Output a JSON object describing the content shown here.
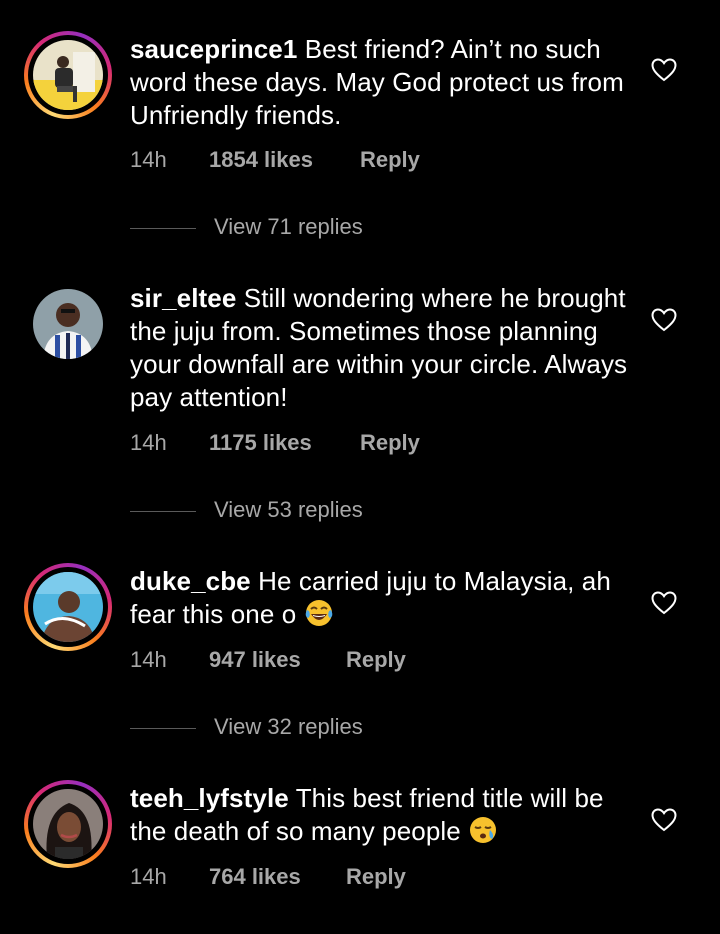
{
  "comments": [
    {
      "username": "sauceprince1",
      "text": "Best friend? Ain’t no such word these days. May God protect us from Unfriendly friends.",
      "time": "14h",
      "likes": "1854 likes",
      "reply": "Reply",
      "view_replies": "View 71 replies",
      "has_story_ring": true
    },
    {
      "username": "sir_eltee",
      "text": "Still wondering where he brought the juju from. Sometimes those planning your downfall are within your circle. Always pay attention!",
      "time": "14h",
      "likes": "1175 likes",
      "reply": "Reply",
      "view_replies": "View 53 replies",
      "has_story_ring": false
    },
    {
      "username": "duke_cbe",
      "text": "He carried juju to Malaysia, ah fear this one o",
      "emoji": "face-with-tears-of-joy",
      "time": "14h",
      "likes": "947 likes",
      "reply": "Reply",
      "view_replies": "View 32 replies",
      "has_story_ring": true
    },
    {
      "username": "teeh_lyfstyle",
      "text": "This best friend title will be the death of so many people",
      "emoji": "sleepy-face",
      "time": "14h",
      "likes": "764 likes",
      "reply": "Reply",
      "has_story_ring": true
    }
  ],
  "colors": {
    "background": "#000000",
    "text": "#ffffff",
    "secondary": "#a8a8a8"
  }
}
